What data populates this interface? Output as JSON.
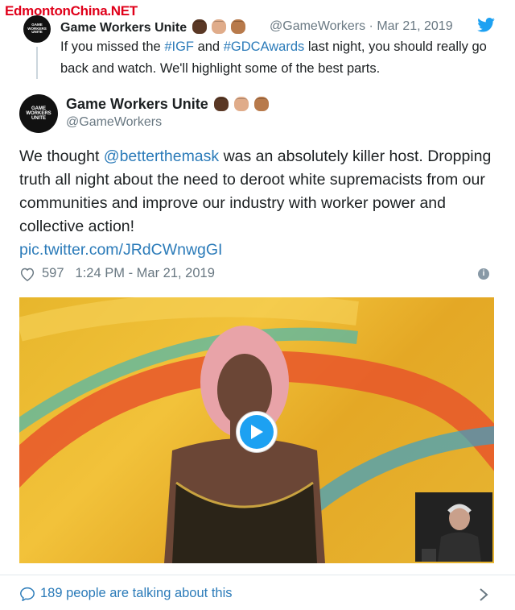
{
  "watermark": "EdmontonChina.NET",
  "reply_tweet": {
    "author_name": "Game Workers Unite",
    "author_handle": "@GameWorkers",
    "date": "Mar 21, 2019",
    "handle_date_sep": "·",
    "avatar_text": "GAME WORKERS UNITE",
    "text_parts": {
      "p1": "If you missed the ",
      "h1": "#IGF",
      "p2": " and ",
      "h2": "#GDCAwards",
      "p3": " last night, you should really go back and watch. We'll highlight some of the best parts."
    }
  },
  "main_tweet": {
    "author_name": "Game Workers Unite",
    "author_handle": "@GameWorkers",
    "avatar_text": "GAME WORKERS UNITE",
    "text_parts": {
      "p1": "We thought ",
      "mention": "@betterthemask",
      "p2": " was an absolutely killer host. Dropping truth all night about the need to deroot white supremacists from our communities and improve our industry with worker power and collective action!",
      "link": "pic.twitter.com/JRdCWnwgGI"
    },
    "likes": "597",
    "timestamp": "1:24 PM - Mar 21, 2019"
  },
  "fist_colors": [
    "#5a3825",
    "#e0ac8a",
    "#b87a4b"
  ],
  "icons": {
    "brand": "twitter-bird-icon",
    "like": "heart-icon",
    "info": "info-icon",
    "play": "play-icon",
    "reply": "speech-bubble-icon",
    "more": "chevron-right-icon"
  },
  "footer": {
    "talking_label": "189 people are talking about this"
  },
  "colors": {
    "link": "#2b7bb9",
    "muted": "#697882",
    "accent": "#1da1f2"
  }
}
